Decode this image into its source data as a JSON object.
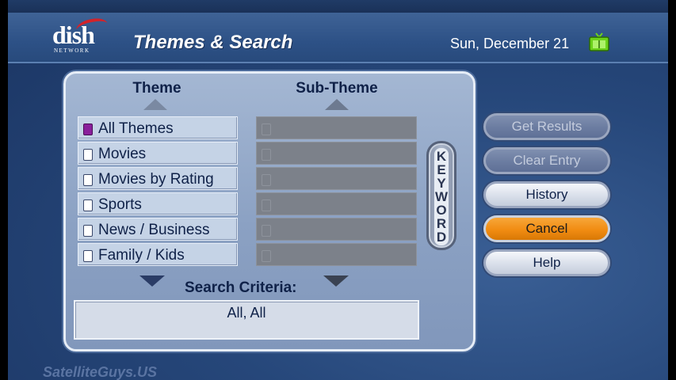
{
  "header": {
    "logo_text": "dish",
    "logo_subtext": "NETWORK",
    "title": "Themes & Search",
    "date": "Sun, December 21"
  },
  "theme_column": {
    "heading": "Theme",
    "items": [
      {
        "label": "All Themes",
        "selected": true
      },
      {
        "label": "Movies",
        "selected": false
      },
      {
        "label": "Movies by Rating",
        "selected": false
      },
      {
        "label": "Sports",
        "selected": false
      },
      {
        "label": "News / Business",
        "selected": false
      },
      {
        "label": "Family / Kids",
        "selected": false
      }
    ]
  },
  "sub_theme_column": {
    "heading": "Sub-Theme",
    "items": [
      "",
      "",
      "",
      "",
      "",
      ""
    ]
  },
  "keyword_button": {
    "label": "KEYWORD"
  },
  "search_criteria": {
    "label": "Search Criteria:",
    "value": "All, All"
  },
  "buttons": {
    "get_results": "Get Results",
    "clear_entry": "Clear Entry",
    "history": "History",
    "cancel": "Cancel",
    "help": "Help"
  },
  "watermark": "SatelliteGuys.US",
  "colors": {
    "accent_orange": "#f18c12",
    "selected_check": "#8a1f9b",
    "panel": "#8ba1c3"
  }
}
